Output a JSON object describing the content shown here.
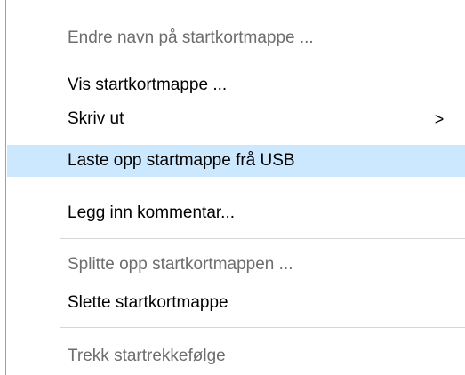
{
  "context_menu": {
    "items": [
      {
        "label": "Endre navn på startkortmappe ...",
        "enabled": false
      },
      {
        "label": "Vis startkortmappe ...",
        "enabled": true
      },
      {
        "label": "Skriv ut",
        "enabled": true,
        "has_submenu": true,
        "submenu_glyph": ">"
      },
      {
        "label": "Laste opp startmappe frå USB",
        "enabled": true,
        "highlighted": true
      },
      {
        "label": "Legg inn kommentar...",
        "enabled": true
      },
      {
        "label": "Splitte opp startkortmappen ...",
        "enabled": false
      },
      {
        "label": "Slette startkortmappe",
        "enabled": true
      },
      {
        "label": "Trekk startrekkefølge",
        "enabled": false
      }
    ],
    "colors": {
      "highlight": "#cce8ff",
      "disabled_text": "#6d6d6d",
      "separator": "#d7d7d7"
    }
  }
}
